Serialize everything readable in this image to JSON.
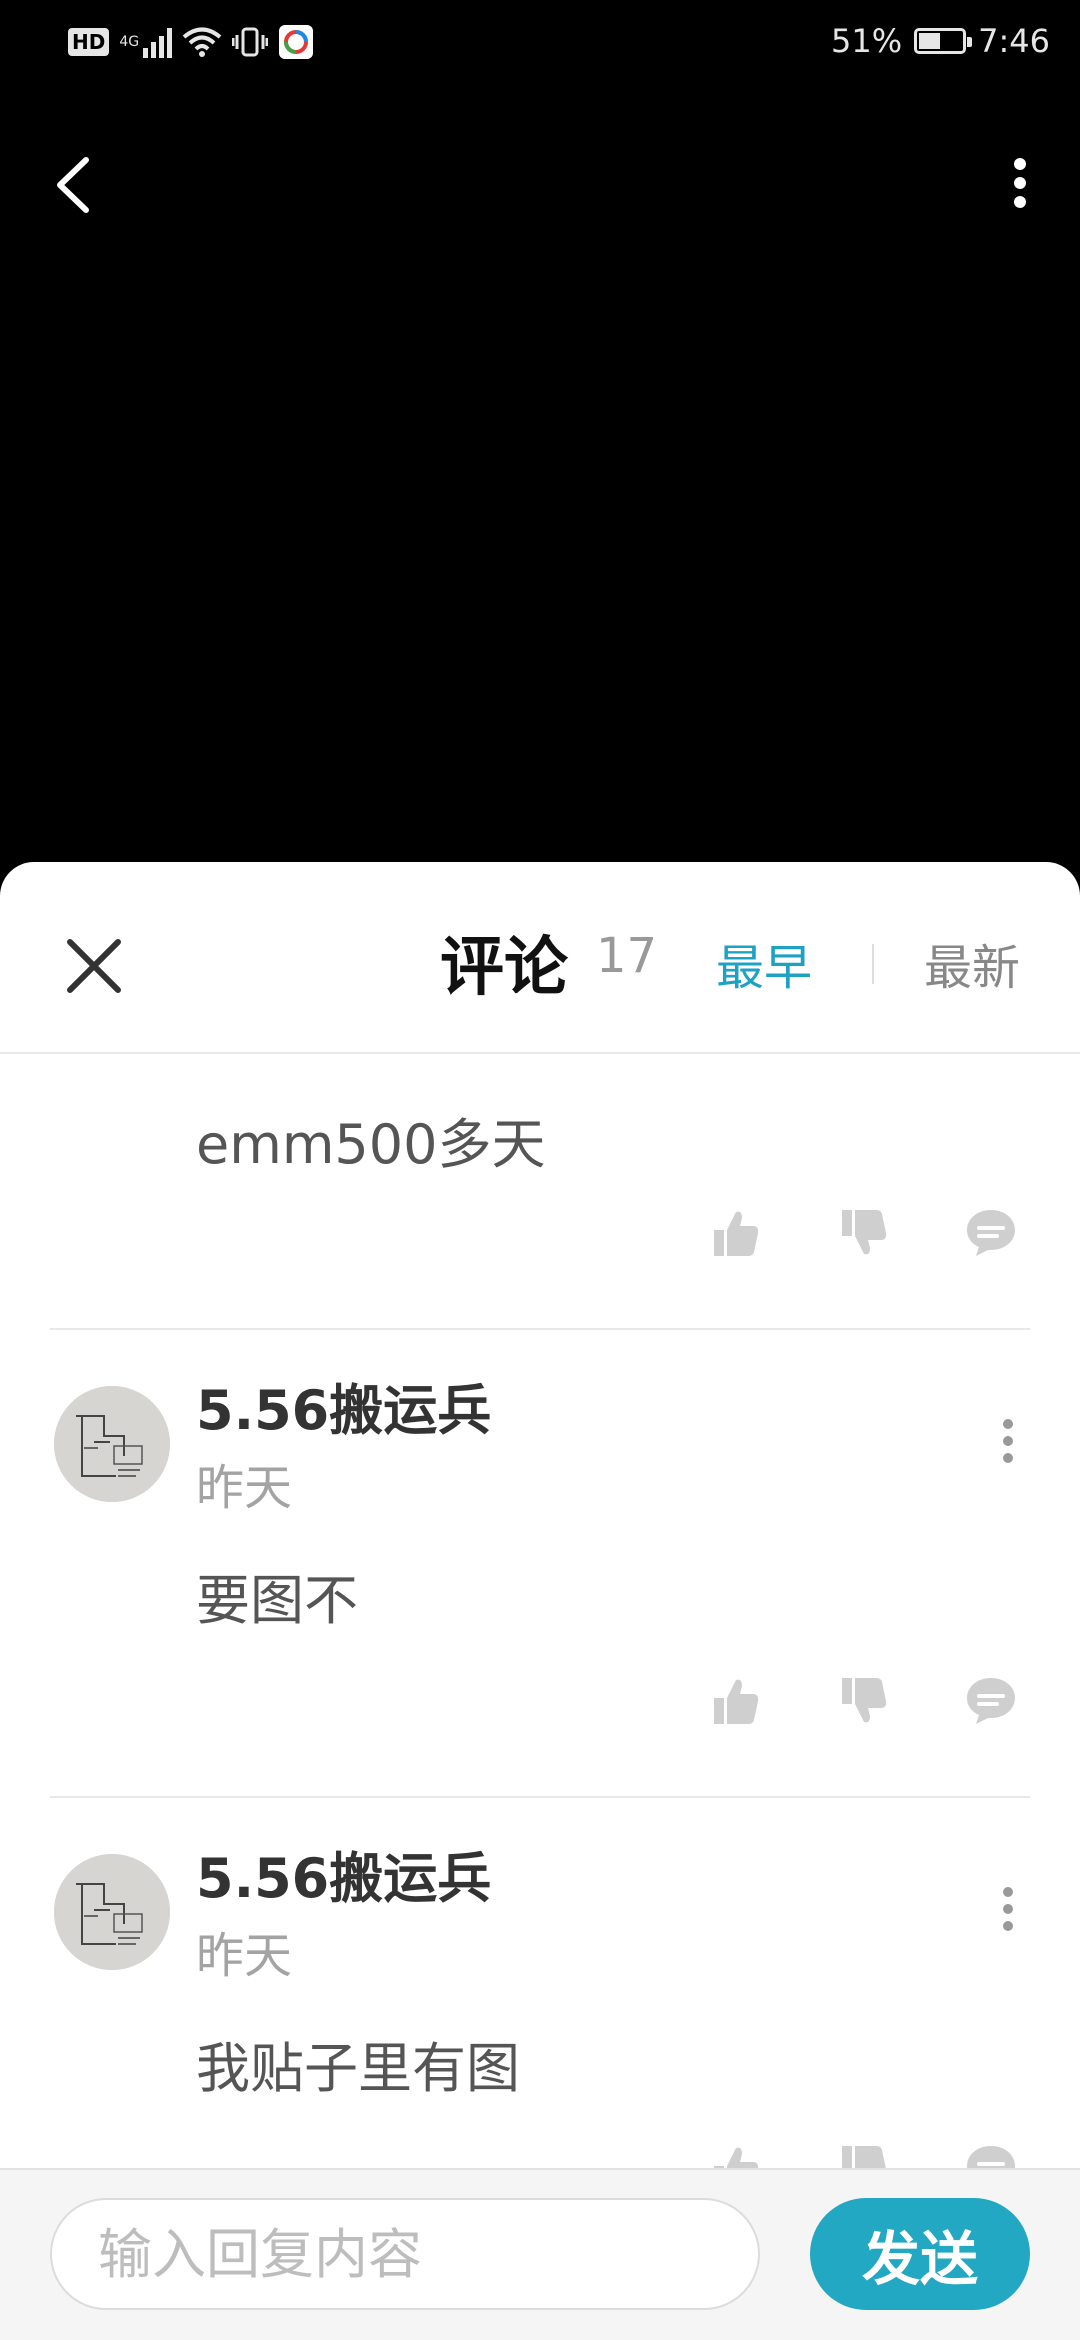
{
  "status_bar": {
    "hd": "HD",
    "network": "4G",
    "battery_text": "51%",
    "battery_level": 0.51,
    "time": "7:46"
  },
  "sheet": {
    "title": "评论",
    "count": "17",
    "sort_earliest": "最早",
    "sort_newest": "最新"
  },
  "comments": [
    {
      "text": "emm500多天"
    },
    {
      "username": "5.56搬运兵",
      "date": "昨天",
      "text": "要图不"
    },
    {
      "username": "5.56搬运兵",
      "date": "昨天",
      "text": "我贴子里有图"
    }
  ],
  "reply": {
    "placeholder": "输入回复内容",
    "send_label": "发送"
  },
  "colors": {
    "accent": "#22a8c2",
    "active_sort": "#1ea2c3",
    "icon_grey": "#cfcfcf"
  }
}
